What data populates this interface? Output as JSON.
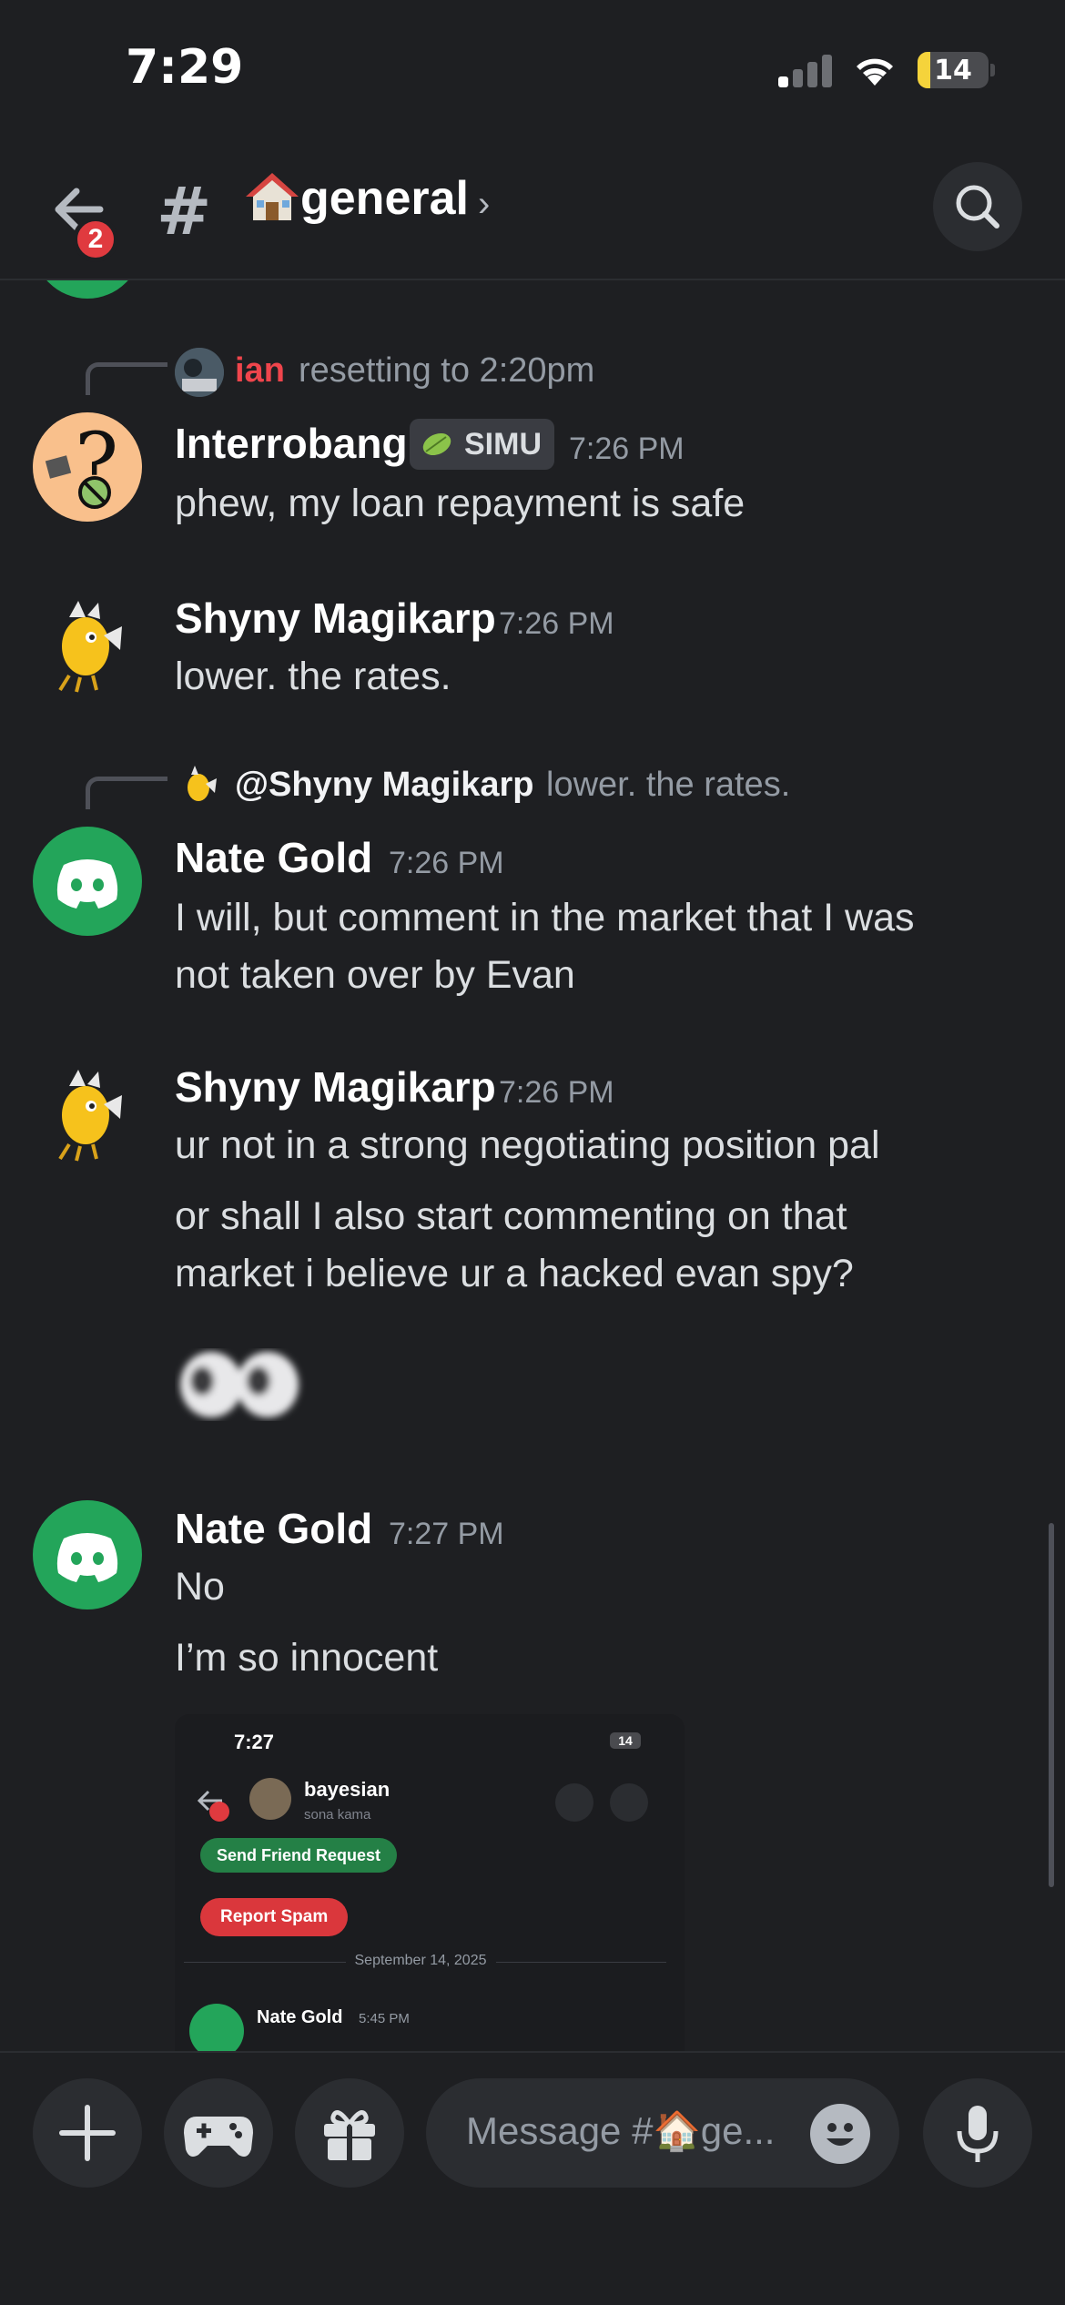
{
  "status_bar": {
    "time": "7:29",
    "battery": "14"
  },
  "header": {
    "badge": "2",
    "hash": "#",
    "channel_name": "general",
    "chevron": "›"
  },
  "messages": {
    "m1": {
      "reply_name": "ian",
      "reply_text": "resetting to 2:20pm",
      "author": "Interrobang",
      "role": "SIMU",
      "time": "7:26 PM",
      "text": "phew, my loan repayment is safe"
    },
    "m2": {
      "author": "Shyny Magikarp",
      "time": "7:26 PM",
      "text": "lower. the rates."
    },
    "m3": {
      "reply_name": "@Shyny Magikarp",
      "reply_text": "lower. the rates.",
      "author": "Nate Gold",
      "time": "7:26 PM",
      "text_line1": "I will, but comment in the market that I was",
      "text_line2": "not taken over by Evan"
    },
    "m4": {
      "author": "Shyny Magikarp",
      "time": "7:26 PM",
      "text1": "ur not in a strong negotiating position pal",
      "text2_line1": "or shall I also start commenting on that",
      "text2_line2": "market i believe ur a hacked evan spy?"
    },
    "m5": {
      "author": "Nate Gold",
      "time": "7:27 PM",
      "text1": "No",
      "text2": "I’m so innocent"
    }
  },
  "attachment": {
    "time": "7:27",
    "battery": "14",
    "name": "bayesian",
    "sub": "sona kama",
    "friend_button": "Send Friend Request",
    "spam_button": "Report Spam",
    "date": "September 14, 2025",
    "author": "Nate Gold",
    "time2": "5:45 PM"
  },
  "composer": {
    "placeholder": "Message #🏠ge..."
  },
  "colors": {
    "background": "#1e1f22",
    "discord_green": "#23a55a",
    "ian_red": "#f0454c",
    "badge_red": "#e03a3f"
  }
}
